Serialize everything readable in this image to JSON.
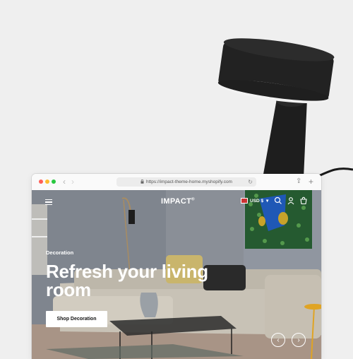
{
  "browser": {
    "url": "https://impact-theme-home.myshopify.com",
    "traffic_colors": {
      "close": "#ff5f57",
      "minimize": "#febc2e",
      "maximize": "#28c840"
    }
  },
  "header": {
    "brand": "IMPACT",
    "brand_mark": "®",
    "currency": "USD $",
    "icons": [
      "menu-icon",
      "search-icon",
      "account-icon",
      "cart-icon"
    ]
  },
  "hero": {
    "kicker": "Decoration",
    "title": "Refresh your living room",
    "cta_label": "Shop Decoration",
    "prev_glyph": "‹",
    "next_glyph": "›"
  },
  "colors": {
    "page_bg": "#efefef",
    "lamp": "#1d1d1d",
    "wall": "#8b9099",
    "floor": "#a9968a",
    "sofa": "#c9c4ba"
  }
}
